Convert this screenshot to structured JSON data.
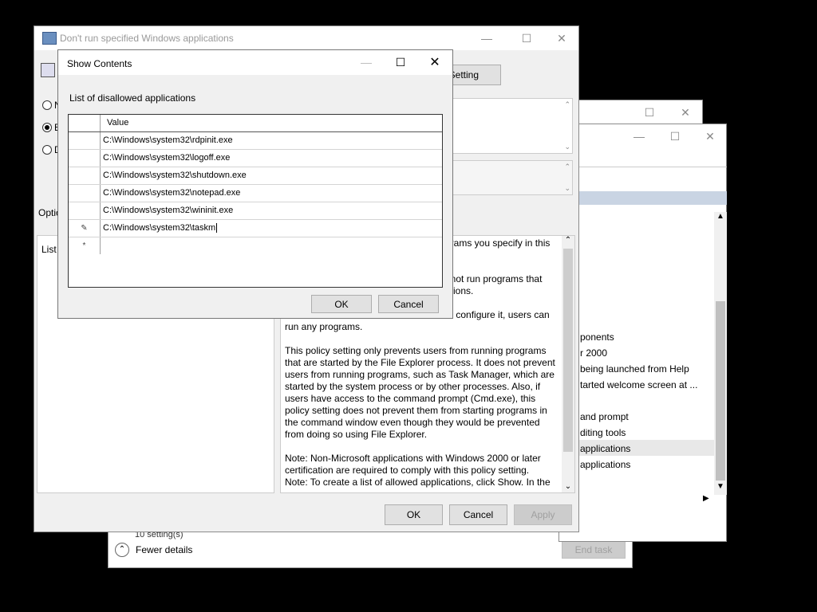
{
  "back_window": {
    "buttons": {
      "end_task": "End task"
    },
    "fewer_details": "Fewer details",
    "status": "10 setting(s)",
    "list_items": [
      "ponents",
      "r 2000",
      " being launched from Help",
      "tarted welcome screen at ...",
      "",
      "and prompt",
      "diting tools",
      "applications",
      "applications"
    ]
  },
  "policy_window": {
    "title": "Don't run specified Windows applications",
    "setting_button": "t Setting",
    "radio_labels": [
      "N",
      "E",
      "D"
    ],
    "options_label": "Optio",
    "list_label": "List",
    "help_text": [
      "grams you specify in this",
      "nnot run programs that",
      "ations.",
      "ot configure it, users can",
      "run any programs.",
      "This policy setting only prevents users from running programs that are started by the File Explorer process. It does not prevent users from running programs, such as Task Manager, which are started by the system process or by other processes.  Also, if users have access to the command prompt (Cmd.exe), this policy setting does not prevent them from starting programs in the command window even though they would be prevented from doing so using File Explorer.",
      "Note: Non-Microsoft applications with Windows 2000 or later certification are required to comply with this policy setting.",
      "Note: To create a list of allowed applications, click Show.  In the"
    ],
    "buttons": {
      "ok": "OK",
      "cancel": "Cancel",
      "apply": "Apply"
    }
  },
  "show_contents": {
    "title": "Show Contents",
    "list_label": "List of disallowed applications",
    "column_header": "Value",
    "rows": [
      {
        "marker": "",
        "value": "C:\\Windows\\system32\\rdpinit.exe"
      },
      {
        "marker": "",
        "value": "C:\\Windows\\system32\\logoff.exe"
      },
      {
        "marker": "",
        "value": "C:\\Windows\\system32\\shutdown.exe"
      },
      {
        "marker": "",
        "value": "C:\\Windows\\system32\\notepad.exe"
      },
      {
        "marker": "",
        "value": "C:\\Windows\\system32\\wininit.exe"
      },
      {
        "marker": "✎",
        "value": "C:\\Windows\\system32\\taskm"
      },
      {
        "marker": "*",
        "value": ""
      }
    ],
    "buttons": {
      "ok": "OK",
      "cancel": "Cancel"
    }
  },
  "icons": {
    "minimize": "minimize-icon",
    "maximize": "maximize-icon",
    "close": "close-icon"
  }
}
